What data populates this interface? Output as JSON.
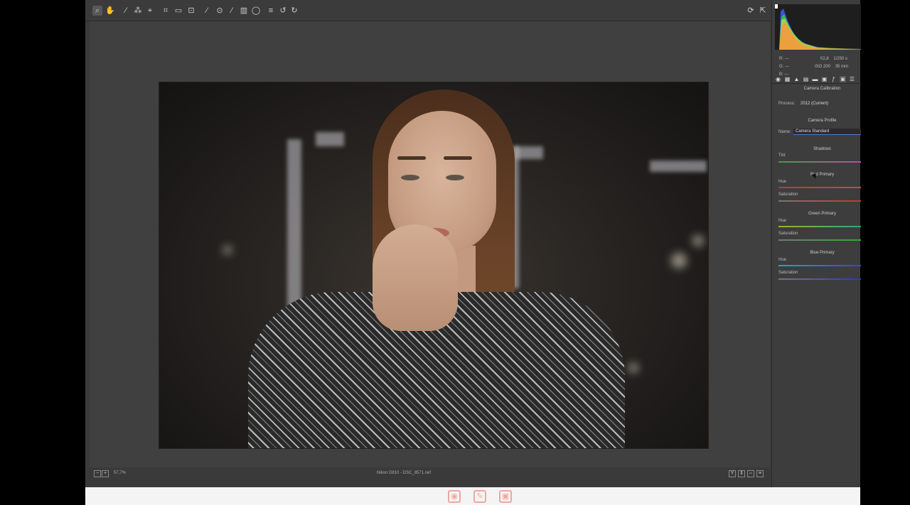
{
  "toolbar": {
    "tools": [
      {
        "icon": "zoom-icon",
        "glyph": "⌕",
        "active": true
      },
      {
        "icon": "hand-icon",
        "glyph": "✋"
      },
      {
        "icon": "white-balance-icon",
        "glyph": "⁄"
      },
      {
        "icon": "color-sampler-icon",
        "glyph": "⁂"
      },
      {
        "icon": "targeted-adjustment-icon",
        "glyph": "⌖"
      },
      {
        "icon": "crop-icon",
        "glyph": "⌗"
      },
      {
        "icon": "straighten-icon",
        "glyph": "▭"
      },
      {
        "icon": "transform-icon",
        "glyph": "⊡"
      },
      {
        "icon": "spot-removal-icon",
        "glyph": "⁄"
      },
      {
        "icon": "red-eye-icon",
        "glyph": "⊙"
      },
      {
        "icon": "adjustment-brush-icon",
        "glyph": "⁄"
      },
      {
        "icon": "graduated-filter-icon",
        "glyph": "▥"
      },
      {
        "icon": "radial-filter-icon",
        "glyph": "◯"
      },
      {
        "icon": "preferences-icon",
        "glyph": "≡"
      },
      {
        "icon": "rotate-left-icon",
        "glyph": "↺"
      },
      {
        "icon": "rotate-right-icon",
        "glyph": "↻"
      }
    ],
    "right_tools": [
      {
        "icon": "sync-icon",
        "glyph": "⟳"
      },
      {
        "icon": "fullscreen-icon",
        "glyph": "⇱"
      }
    ]
  },
  "camera_info": {
    "r_label": "R:",
    "g_label": "G:",
    "b_label": "B:",
    "r_value": "---",
    "g_value": "---",
    "b_value": "---",
    "aperture": "f/2,8",
    "shutter": "1/250 s",
    "iso": "ISO 200",
    "focal": "35 mm"
  },
  "panel": {
    "tabs": [
      "basic-icon",
      "tone-curve-icon",
      "detail-icon",
      "hsl-icon",
      "split-toning-icon",
      "lens-icon",
      "fx-icon",
      "camera-calibration-icon",
      "presets-icon"
    ],
    "title": "Camera Calibration",
    "process_label": "Process:",
    "process_value": "2012 (Current)",
    "camera_profile_title": "Camera Profile",
    "name_label": "Name:",
    "name_value": "Camera Standard",
    "shadows": {
      "title": "Shadows",
      "tint_label": "Tint"
    },
    "red_primary": {
      "title": "Red Primary",
      "hue_label": "Hue",
      "saturation_label": "Saturation"
    },
    "green_primary": {
      "title": "Green Primary",
      "hue_label": "Hue",
      "saturation_label": "Saturation"
    },
    "blue_primary": {
      "title": "Blue Primary",
      "hue_label": "Hue",
      "saturation_label": "Saturation"
    }
  },
  "statusbar": {
    "zoom": "57,7%",
    "filename": "Nikon D810  -  DSC_8571.nef",
    "right_buttons": [
      "Y",
      "⇕",
      "⇔",
      "≡"
    ]
  },
  "bottom_strip": {
    "icons": [
      "camera-icon",
      "edit-icon",
      "picture-icon"
    ]
  },
  "colors": {
    "accent": "#4a7bd1",
    "panel_bg": "#3d3d3d",
    "canvas_bg": "#404040",
    "strip_icon": "#f0a7a0"
  }
}
